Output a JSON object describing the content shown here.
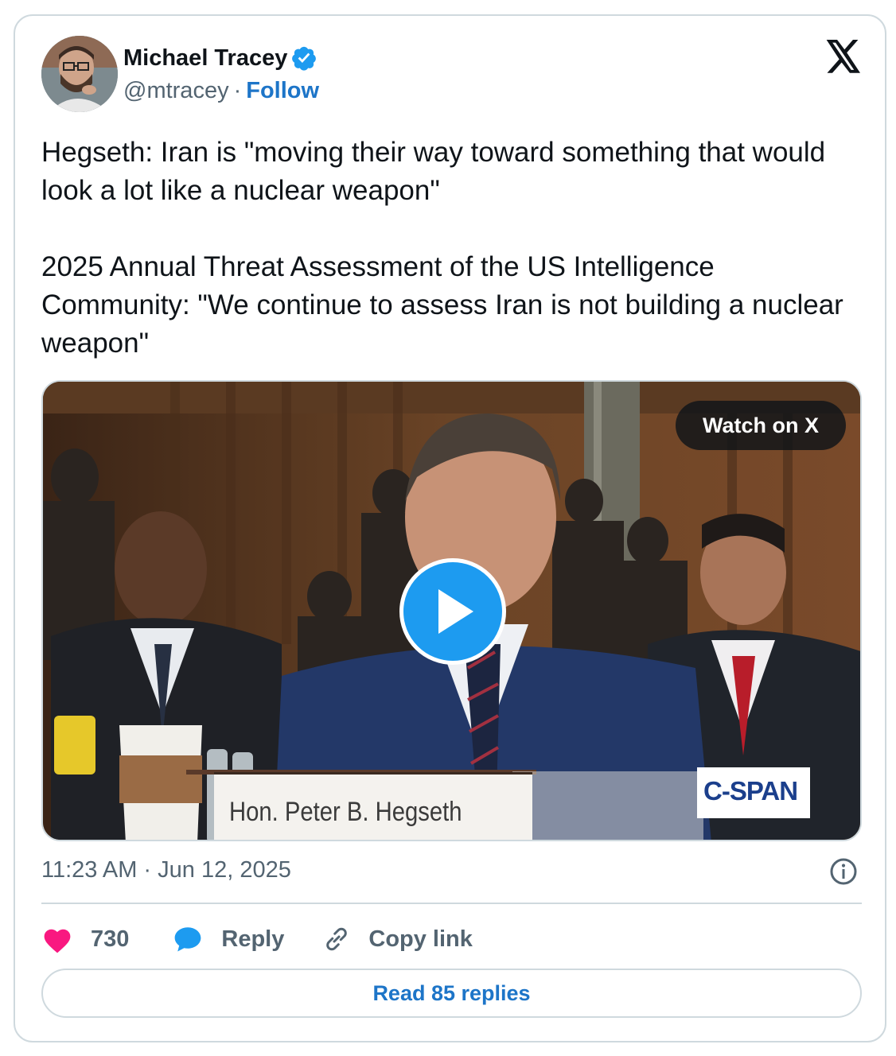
{
  "author": {
    "name": "Michael Tracey",
    "handle": "@mtracey",
    "separator": "·",
    "follow_label": "Follow"
  },
  "tweet": {
    "text": "Hegseth: Iran is \"moving their way toward something that would look a lot like a nuclear weapon\"\n\n2025 Annual Threat Assessment of the US Intelligence Community: \"We continue to assess Iran is not building a nuclear weapon\"",
    "timestamp": "11:23 AM · Jun 12, 2025"
  },
  "media": {
    "watch_label": "Watch on X",
    "nameplate_text": "Hon. Peter B. Hegseth",
    "broadcaster_logo": "C-SPAN"
  },
  "actions": {
    "like_count": "730",
    "reply_label": "Reply",
    "copy_link_label": "Copy link"
  },
  "read_replies_label": "Read 85 replies",
  "icons": [
    "verified-badge-icon",
    "x-logo-icon",
    "play-icon",
    "info-icon",
    "heart-icon",
    "reply-bubble-icon",
    "link-icon"
  ],
  "colors": {
    "accent": "#1d9bf0",
    "link": "#1d75c8",
    "heart": "#f91880",
    "secondary_text": "#536471",
    "border": "#cfd9de"
  }
}
